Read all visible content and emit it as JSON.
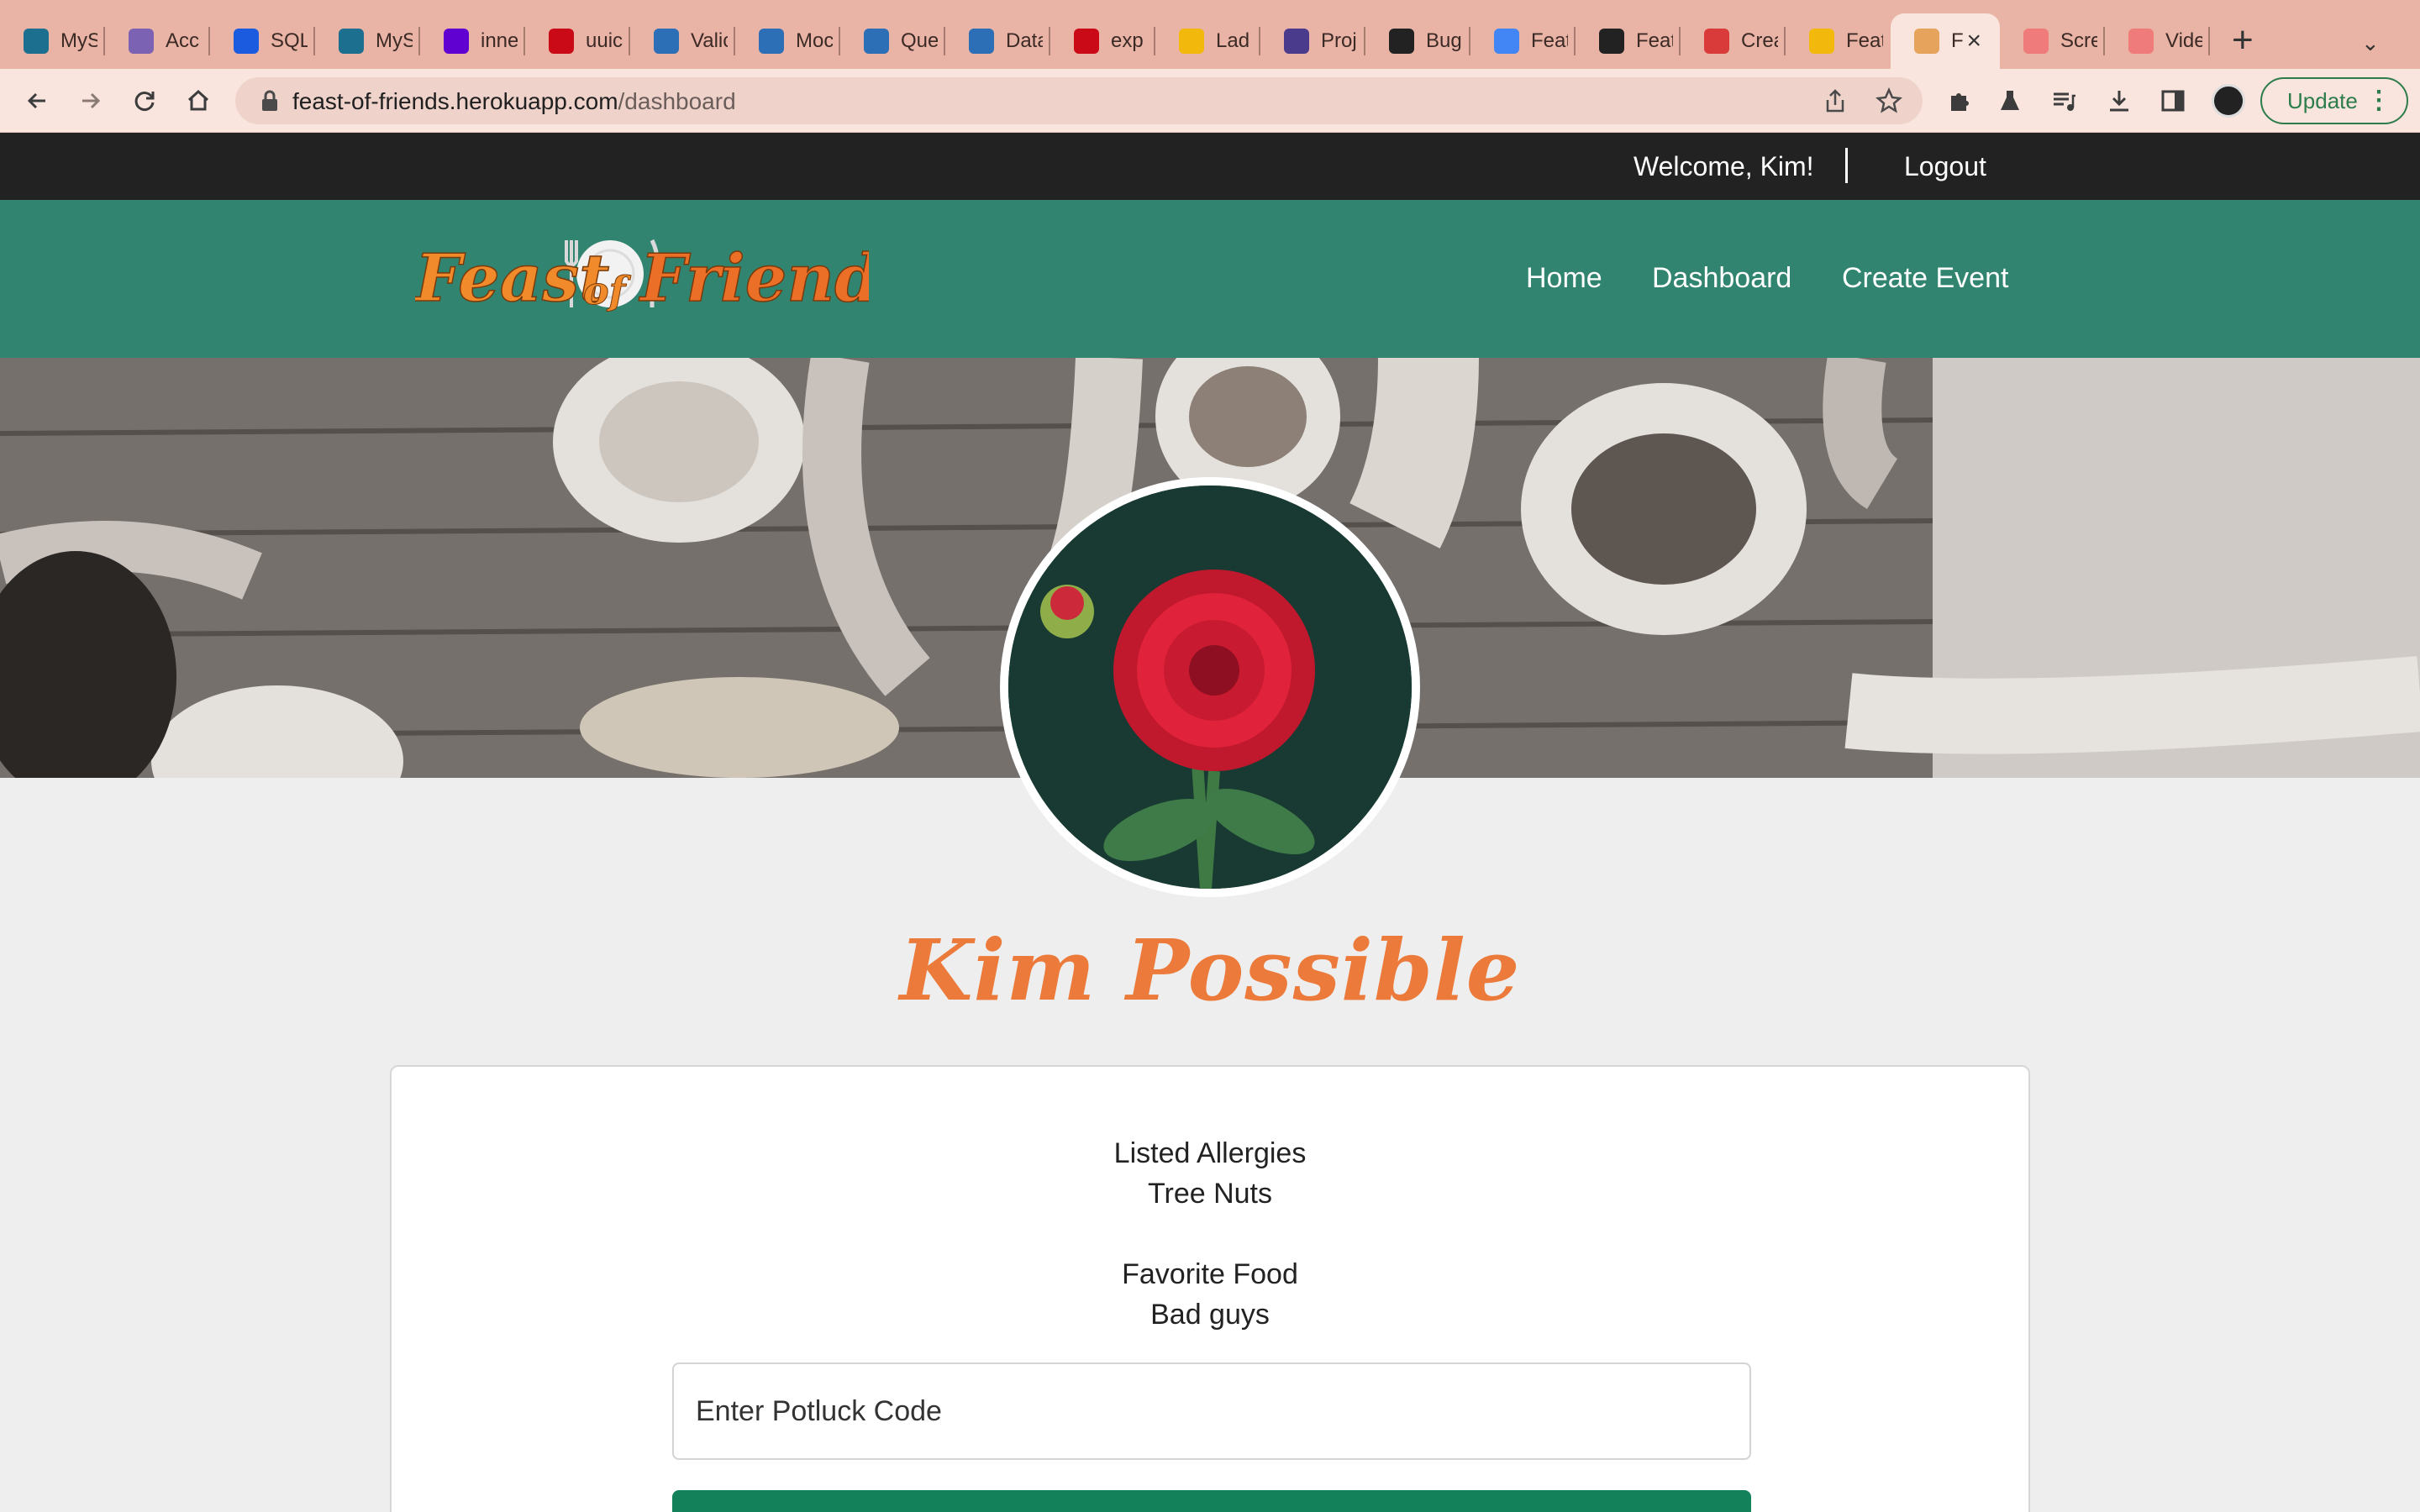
{
  "browser": {
    "tabs": [
      {
        "title": "MyS",
        "icon": "mysql-icon",
        "color": "#1d6f8f"
      },
      {
        "title": "Acc",
        "icon": "heroku-icon",
        "color": "#7b62b3"
      },
      {
        "title": "SQL",
        "icon": "dot-icon",
        "color": "#1a5be0"
      },
      {
        "title": "MyS",
        "icon": "mysql-icon",
        "color": "#1d6f8f"
      },
      {
        "title": "inne",
        "icon": "yahoo-icon",
        "color": "#6001d2"
      },
      {
        "title": "uuic",
        "icon": "npm-icon",
        "color": "#cb0a17"
      },
      {
        "title": "Valic",
        "icon": "cube-icon",
        "color": "#2c6fb6"
      },
      {
        "title": "Moc",
        "icon": "cube-icon",
        "color": "#2c6fb6"
      },
      {
        "title": "Que",
        "icon": "cube-icon",
        "color": "#2c6fb6"
      },
      {
        "title": "Data",
        "icon": "cube-icon",
        "color": "#2c6fb6"
      },
      {
        "title": "exp",
        "icon": "npm-icon",
        "color": "#cb0a17"
      },
      {
        "title": "Lad",
        "icon": "slides-icon",
        "color": "#f2b90c"
      },
      {
        "title": "Proj",
        "icon": "notion-n-icon",
        "color": "#4a3b8c"
      },
      {
        "title": "Bug",
        "icon": "github-icon",
        "color": "#222222"
      },
      {
        "title": "Feat",
        "icon": "docs-icon",
        "color": "#4285f4"
      },
      {
        "title": "Feat",
        "icon": "globe-icon",
        "color": "#222222"
      },
      {
        "title": "Crea",
        "icon": "swoosh-icon",
        "color": "#d93a3a"
      },
      {
        "title": "Feat",
        "icon": "slides-icon",
        "color": "#f2b90c"
      },
      {
        "title": "F",
        "icon": "feast-icon",
        "color": "#e6a35b"
      },
      {
        "title": "Scre",
        "icon": "record-icon",
        "color": "#ef7b7b"
      },
      {
        "title": "Vide",
        "icon": "record-icon",
        "color": "#ef7b7b"
      }
    ],
    "url_domain": "feast-of-friends.herokuapp.com",
    "url_path": "/dashboard",
    "update_label": "Update"
  },
  "topbar": {
    "welcome": "Welcome, Kim!",
    "logout": "Logout"
  },
  "nav": {
    "logo_alt": "Feast of Friends",
    "logo_word1": "Feast",
    "logo_word2": "of",
    "logo_word3": "Friends",
    "links": [
      "Home",
      "Dashboard",
      "Create Event"
    ]
  },
  "profile": {
    "name": "Kim Possible",
    "allergies_label": "Listed Allergies",
    "allergies_value": "Tree Nuts",
    "food_label": "Favorite Food",
    "food_value": "Bad guys",
    "code_placeholder": "Enter Potluck Code"
  },
  "colors": {
    "topbar": "#222222",
    "navbar": "#318470",
    "accent_name": "#ec7a3a",
    "button": "#13825a"
  }
}
